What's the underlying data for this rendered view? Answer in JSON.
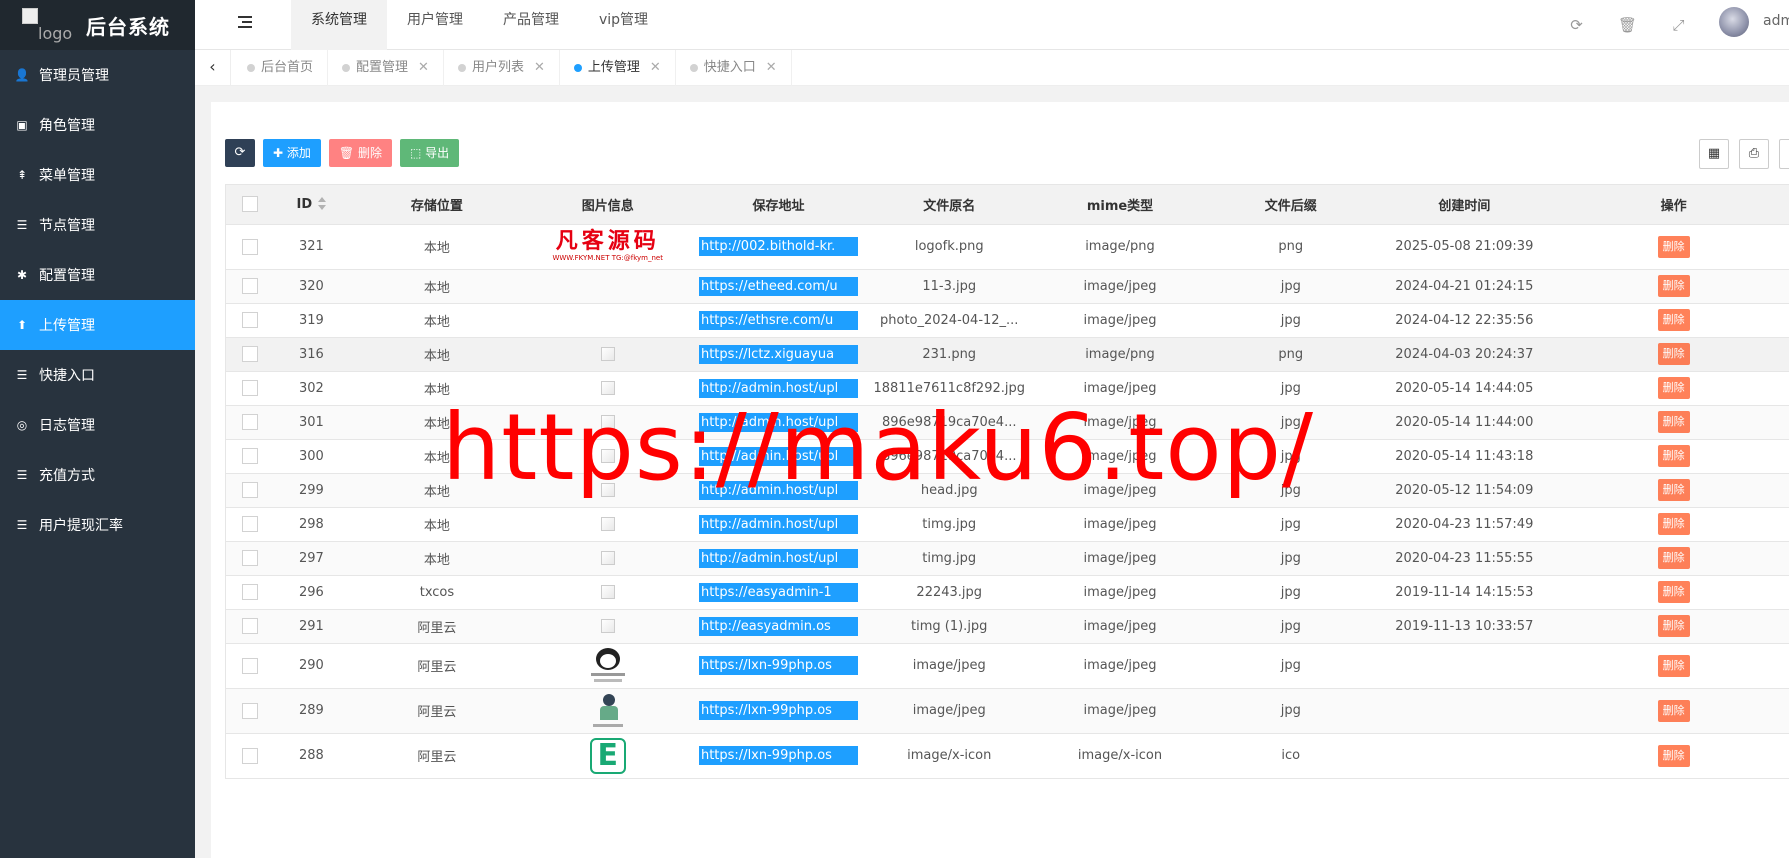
{
  "app": {
    "title": "后台系统",
    "logo_alt": "logo"
  },
  "sidebar": {
    "items": [
      {
        "label": "管理员管理",
        "icon": "user-icon"
      },
      {
        "label": "角色管理",
        "icon": "role-icon"
      },
      {
        "label": "菜单管理",
        "icon": "tree-icon"
      },
      {
        "label": "节点管理",
        "icon": "list-icon"
      },
      {
        "label": "配置管理",
        "icon": "gear-icon"
      },
      {
        "label": "上传管理",
        "icon": "arrow-up-icon",
        "active": true
      },
      {
        "label": "快捷入口",
        "icon": "list-icon"
      },
      {
        "label": "日志管理",
        "icon": "globe-icon"
      },
      {
        "label": "充值方式",
        "icon": "list-icon"
      },
      {
        "label": "用户提现汇率",
        "icon": "list-icon"
      }
    ]
  },
  "header": {
    "tabs": [
      {
        "label": "系统管理",
        "active": true
      },
      {
        "label": "用户管理"
      },
      {
        "label": "产品管理"
      },
      {
        "label": "vip管理"
      }
    ],
    "user": "admin"
  },
  "page_tabs": [
    {
      "label": "后台首页",
      "closable": false
    },
    {
      "label": "配置管理",
      "closable": true
    },
    {
      "label": "用户列表",
      "closable": true
    },
    {
      "label": "上传管理",
      "closable": true,
      "active": true
    },
    {
      "label": "快捷入口",
      "closable": true
    }
  ],
  "toolbar": {
    "add_label": "添加",
    "delete_label": "删除",
    "export_label": "导出"
  },
  "table": {
    "columns": [
      "ID",
      "存储位置",
      "图片信息",
      "保存地址",
      "文件原名",
      "mime类型",
      "文件后缀",
      "创建时间",
      "操作"
    ],
    "delete_label": "删除",
    "rows": [
      {
        "id": "321",
        "storage": "本地",
        "image": "logo",
        "url": "http://002.bithold-kr.",
        "name": "logofk.png",
        "mime": "image/png",
        "ext": "png",
        "time": "2025-05-08 21:09:39"
      },
      {
        "id": "320",
        "storage": "本地",
        "image": "none",
        "url": "https://etheed.com/u",
        "name": "11-3.jpg",
        "mime": "image/jpeg",
        "ext": "jpg",
        "time": "2024-04-21 01:24:15"
      },
      {
        "id": "319",
        "storage": "本地",
        "image": "none",
        "url": "https://ethsre.com/u",
        "name": "photo_2024-04-12_...",
        "mime": "image/jpeg",
        "ext": "jpg",
        "time": "2024-04-12 22:35:56"
      },
      {
        "id": "316",
        "storage": "本地",
        "image": "broken",
        "url": "https://lctz.xiguayua",
        "name": "231.png",
        "mime": "image/png",
        "ext": "png",
        "time": "2024-04-03 20:24:37"
      },
      {
        "id": "302",
        "storage": "本地",
        "image": "broken",
        "url": "http://admin.host/upl",
        "name": "18811e7611c8f292.jpg",
        "mime": "image/jpeg",
        "ext": "jpg",
        "time": "2020-05-14 14:44:05"
      },
      {
        "id": "301",
        "storage": "本地",
        "image": "broken",
        "url": "http://admin.host/upl",
        "name": "896e98719ca70e4...",
        "mime": "image/jpeg",
        "ext": "jpg",
        "time": "2020-05-14 11:44:00"
      },
      {
        "id": "300",
        "storage": "本地",
        "image": "broken",
        "url": "http://admin.host/upl",
        "name": "896e98719ca70e4...",
        "mime": "image/jpeg",
        "ext": "jpg",
        "time": "2020-05-14 11:43:18"
      },
      {
        "id": "299",
        "storage": "本地",
        "image": "broken",
        "url": "http://admin.host/upl",
        "name": "head.jpg",
        "mime": "image/jpeg",
        "ext": "jpg",
        "time": "2020-05-12 11:54:09"
      },
      {
        "id": "298",
        "storage": "本地",
        "image": "broken",
        "url": "http://admin.host/upl",
        "name": "timg.jpg",
        "mime": "image/jpeg",
        "ext": "jpg",
        "time": "2020-04-23 11:57:49"
      },
      {
        "id": "297",
        "storage": "本地",
        "image": "broken",
        "url": "http://admin.host/upl",
        "name": "timg.jpg",
        "mime": "image/jpeg",
        "ext": "jpg",
        "time": "2020-04-23 11:55:55"
      },
      {
        "id": "296",
        "storage": "txcos",
        "image": "broken",
        "url": "https://easyadmin-1",
        "name": "22243.jpg",
        "mime": "image/jpeg",
        "ext": "jpg",
        "time": "2019-11-14 14:15:53"
      },
      {
        "id": "291",
        "storage": "阿里云",
        "image": "broken",
        "url": "http://easyadmin.os",
        "name": "timg (1).jpg",
        "mime": "image/jpeg",
        "ext": "jpg",
        "time": "2019-11-13 10:33:57"
      },
      {
        "id": "290",
        "storage": "阿里云",
        "image": "face",
        "url": "https://lxn-99php.os",
        "name": "image/jpeg",
        "mime": "image/jpeg",
        "ext": "jpg",
        "time": ""
      },
      {
        "id": "289",
        "storage": "阿里云",
        "image": "man",
        "url": "https://lxn-99php.os",
        "name": "image/jpeg",
        "mime": "image/jpeg",
        "ext": "jpg",
        "time": ""
      },
      {
        "id": "288",
        "storage": "阿里云",
        "image": "e",
        "url": "https://lxn-99php.os",
        "name": "image/x-icon",
        "mime": "image/x-icon",
        "ext": "ico",
        "time": ""
      }
    ]
  },
  "logo_thumb": {
    "big": "凡客源码",
    "small": "WWW.FKYM.NET    TG:@fkym_net"
  },
  "watermark": "https://maku6.top/"
}
